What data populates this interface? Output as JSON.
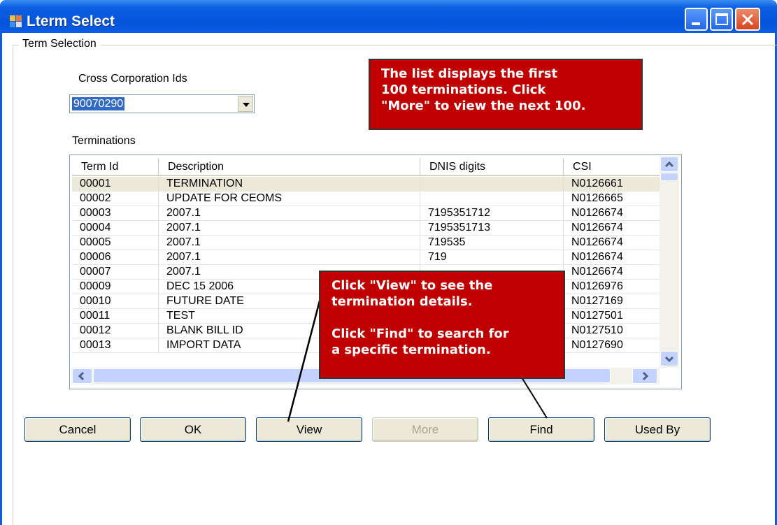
{
  "window": {
    "title": "Lterm Select",
    "colors": {
      "titlebar": "#0555dc",
      "callout": "#c00000",
      "selection": "#316ac5"
    }
  },
  "group": {
    "label": "Term Selection"
  },
  "cross_corp": {
    "label": "Cross Corporation Ids",
    "selected_value": "90070290"
  },
  "terminations": {
    "label": "Terminations",
    "columns": [
      "Term Id",
      "Description",
      "DNIS digits",
      "CSI"
    ],
    "rows": [
      [
        "00001",
        "TERMINATION",
        "",
        "N0126661"
      ],
      [
        "00002",
        "UPDATE FOR CEOMS",
        "",
        "N0126665"
      ],
      [
        "00003",
        "2007.1",
        "7195351712",
        "N0126674"
      ],
      [
        "00004",
        "2007.1",
        "7195351713",
        "N0126674"
      ],
      [
        "00005",
        "2007.1",
        "719535",
        "N0126674"
      ],
      [
        "00006",
        "2007.1",
        "719",
        "N0126674"
      ],
      [
        "00007",
        "2007.1",
        "",
        "N0126674"
      ],
      [
        "00009",
        "DEC 15 2006",
        "",
        "N0126976"
      ],
      [
        "00010",
        "FUTURE DATE",
        "",
        "N0127169"
      ],
      [
        "00011",
        "TEST",
        "",
        "N0127501"
      ],
      [
        "00012",
        "BLANK BILL ID",
        "",
        "N0127510"
      ],
      [
        "00013",
        "IMPORT DATA",
        "",
        "N0127690"
      ]
    ]
  },
  "buttons": {
    "cancel": "Cancel",
    "ok": "OK",
    "view": "View",
    "more": "More",
    "find": "Find",
    "used_by": "Used By"
  },
  "callouts": {
    "top": [
      "The list displays the first",
      "100 terminations. Click",
      "\"More\" to view the next 100."
    ],
    "view_line1": "Click \"View\" to see the",
    "view_line2": "termination details.",
    "find_line1": "Click \"Find\" to search for",
    "find_line2": "a specific termination."
  },
  "icons": {
    "app": "window-app-icon",
    "minimize": "minimize-icon",
    "maximize": "maximize-icon",
    "close": "close-icon",
    "dropdown": "chevron-down-icon",
    "scroll_up": "chevron-up-icon",
    "scroll_down": "chevron-down-icon",
    "scroll_left": "chevron-left-icon",
    "scroll_right": "chevron-right-icon"
  }
}
